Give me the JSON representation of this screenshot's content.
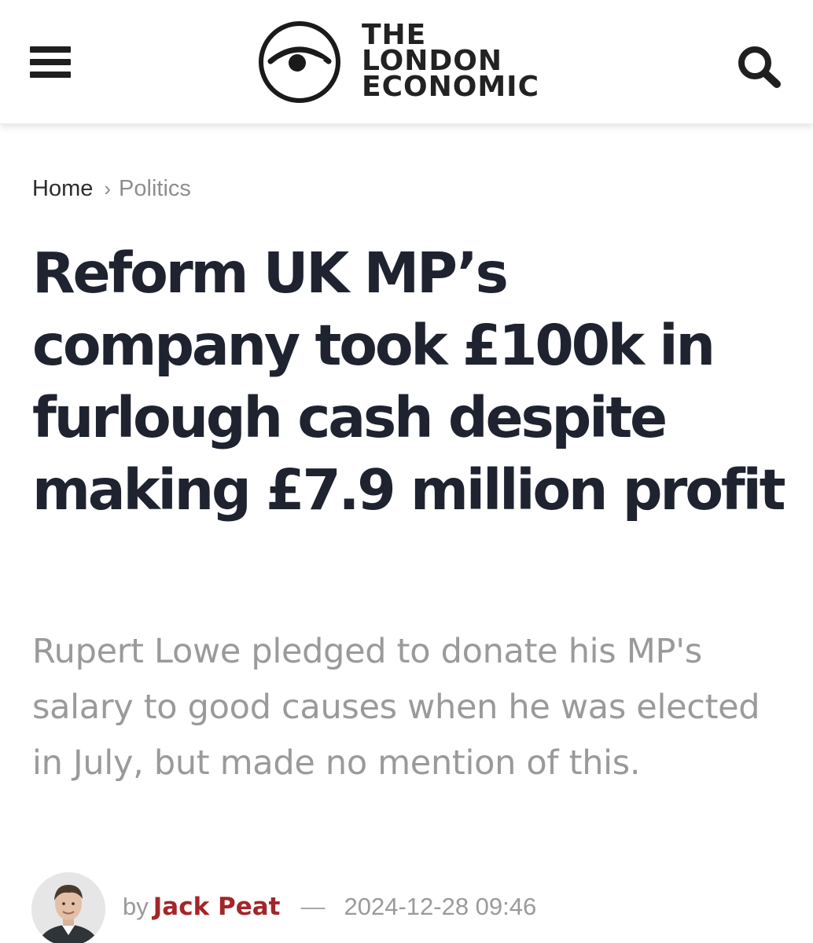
{
  "header": {
    "menu_icon": "hamburger-menu-icon",
    "logo_icon": "eye-icon",
    "logo_lines": [
      "THE",
      "LONDON",
      "ECONOMIC"
    ],
    "search_icon": "search-icon"
  },
  "breadcrumb": {
    "home": "Home",
    "separator": "›",
    "category": "Politics"
  },
  "article": {
    "headline": "Reform UK MP’s company took £100k in furlough cash despite making £7.9 million profit",
    "standfirst": "Rupert Lowe pledged to donate his MP's salary to good causes when he was elected in July, but made no mention of this.",
    "byline": {
      "by": "by",
      "author": "Jack Peat",
      "dash": "—",
      "date": "2024-12-28 09:46"
    }
  },
  "colors": {
    "headline": "#1f2330",
    "standfirst": "#9a9a9a",
    "author": "#a3262a"
  }
}
